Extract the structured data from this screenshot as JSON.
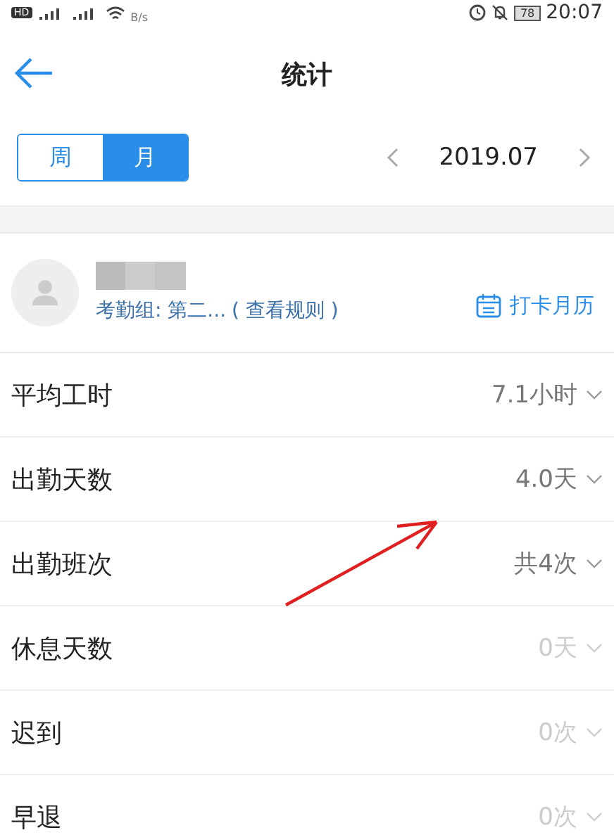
{
  "status_bar": {
    "hd_badge": "HD",
    "speed_unit": "B/s",
    "battery": "78",
    "time": "20:07"
  },
  "header": {
    "title": "统计"
  },
  "period_tabs": [
    {
      "label": "周",
      "selected": false
    },
    {
      "label": "月",
      "selected": true
    }
  ],
  "month": "2019.07",
  "user": {
    "group": "考勤组: 第二...",
    "rules_link": "( 查看规则 )",
    "calendar_link": "打卡月历"
  },
  "stats": [
    {
      "label": "平均工时",
      "value": "7.1小时",
      "muted": false
    },
    {
      "label": "出勤天数",
      "value": "4.0天",
      "muted": false
    },
    {
      "label": "出勤班次",
      "value": "共4次",
      "muted": false
    },
    {
      "label": "休息天数",
      "value": "0天",
      "muted": true
    },
    {
      "label": "迟到",
      "value": "0次",
      "muted": true
    },
    {
      "label": "早退",
      "value": "0次",
      "muted": true
    }
  ]
}
